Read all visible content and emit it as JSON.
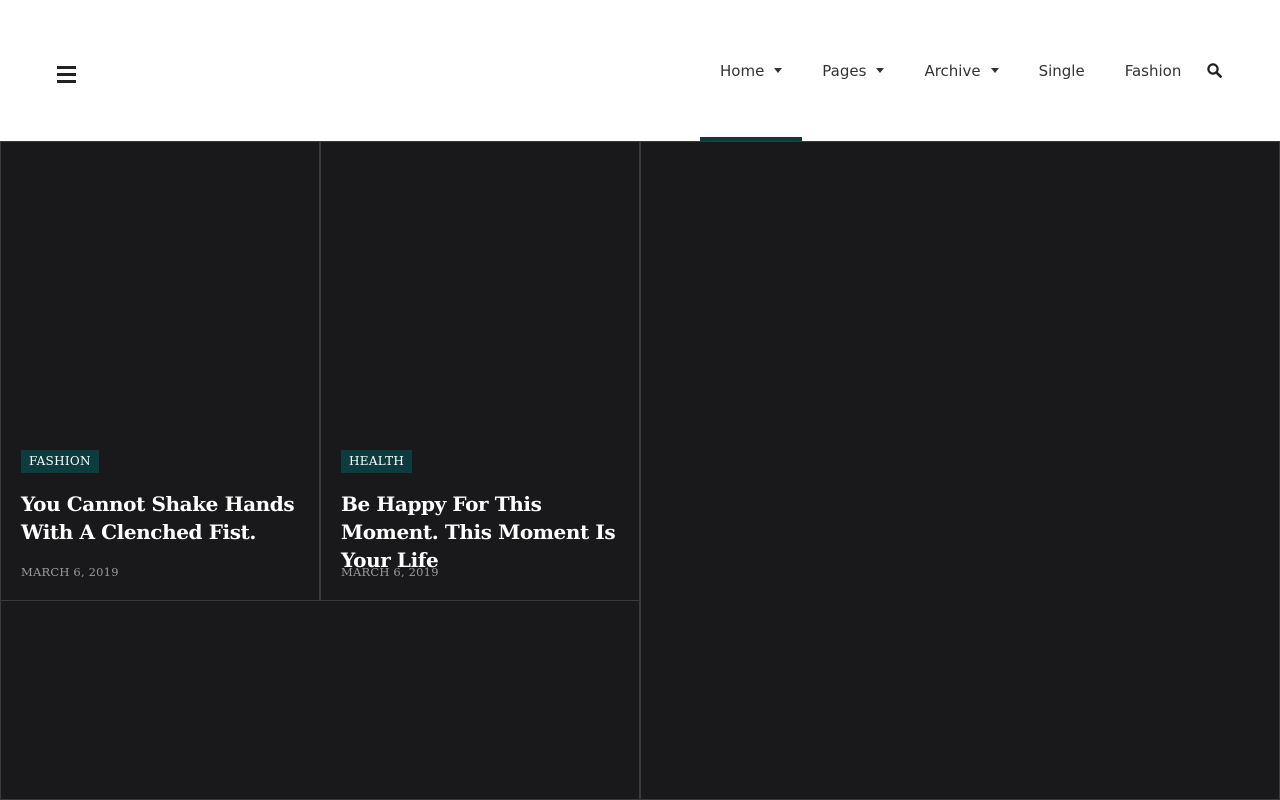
{
  "nav": {
    "items": [
      {
        "label": "Home",
        "dropdown": true,
        "active": true
      },
      {
        "label": "Pages",
        "dropdown": true,
        "active": false
      },
      {
        "label": "Archive",
        "dropdown": true,
        "active": false
      },
      {
        "label": "Single",
        "dropdown": false,
        "active": false
      },
      {
        "label": "Fashion",
        "dropdown": false,
        "active": false
      }
    ]
  },
  "icons": {
    "menu": "hamburger-menu-icon",
    "search": "search-icon",
    "dropdown": "caret-down-icon"
  },
  "colors": {
    "accent": "#0e3b3a",
    "badge_bg": "#0c3c3e",
    "page_bg": "#181818",
    "card_bg": "#19191b",
    "text_light": "#ffffff",
    "text_muted": "#9a9a9a"
  },
  "posts": [
    {
      "category": "FASHION",
      "title": "You Cannot Shake Hands With A Clenched Fist.",
      "date": "MARCH 6, 2019"
    },
    {
      "category": "HEALTH",
      "title": "Be Happy For This Moment. This Moment Is Your Life",
      "date": "MARCH 6, 2019"
    }
  ]
}
